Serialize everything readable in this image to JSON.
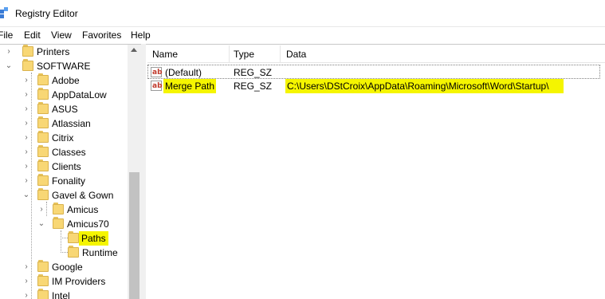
{
  "window": {
    "title": "Registry Editor",
    "icon": "registry-editor-icon"
  },
  "menu": {
    "file": "File",
    "edit": "Edit",
    "view": "View",
    "favorites": "Favorites",
    "help": "Help"
  },
  "tree": {
    "items": [
      {
        "label": "Printers",
        "expanded": false
      },
      {
        "label": "SOFTWARE",
        "expanded": true
      },
      {
        "label": "Adobe",
        "expanded": false
      },
      {
        "label": "AppDataLow",
        "expanded": false
      },
      {
        "label": "ASUS",
        "expanded": false
      },
      {
        "label": "Atlassian",
        "expanded": false
      },
      {
        "label": "Citrix",
        "expanded": false
      },
      {
        "label": "Classes",
        "expanded": false
      },
      {
        "label": "Clients",
        "expanded": false
      },
      {
        "label": "Fonality",
        "expanded": false
      },
      {
        "label": "Gavel & Gown",
        "expanded": true
      },
      {
        "label": "Amicus",
        "expanded": false
      },
      {
        "label": "Amicus70",
        "expanded": true
      },
      {
        "label": "Paths",
        "selected": true
      },
      {
        "label": "Runtime"
      },
      {
        "label": "Google",
        "expanded": false
      },
      {
        "label": "IM Providers",
        "expanded": false
      },
      {
        "label": "Intel",
        "expanded": false
      }
    ]
  },
  "list": {
    "columns": {
      "name": "Name",
      "type": "Type",
      "data": "Data"
    },
    "rows": [
      {
        "icon": "ab",
        "name": "(Default)",
        "type": "REG_SZ",
        "data": ""
      },
      {
        "icon": "ab",
        "name": "Merge Path",
        "type": "REG_SZ",
        "data": "C:\\Users\\DStCroix\\AppData\\Roaming\\Microsoft\\Word\\Startup\\"
      }
    ]
  },
  "colors": {
    "highlight": "#f5f500",
    "folder": "#f8d775"
  }
}
